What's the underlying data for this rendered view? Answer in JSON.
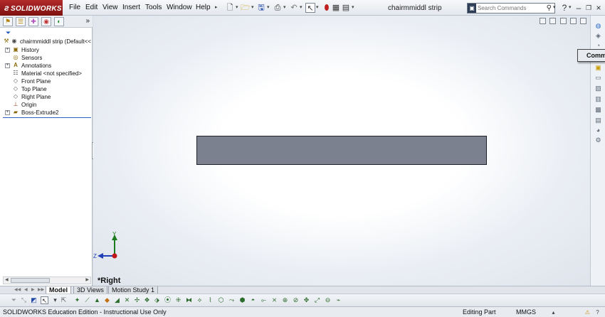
{
  "app": {
    "brand": "SOLIDWORKS",
    "document_title": "chairmmiddl strip"
  },
  "menu": [
    "File",
    "Edit",
    "View",
    "Insert",
    "Tools",
    "Window",
    "Help"
  ],
  "search": {
    "placeholder": "Search Commands"
  },
  "tree": {
    "root": "chairmmiddl strip  (Default<<",
    "items": [
      "History",
      "Sensors",
      "Annotations",
      "Material <not specified>",
      "Front Plane",
      "Top Plane",
      "Right Plane",
      "Origin",
      "Boss-Extrude2"
    ]
  },
  "viewport": {
    "view_label": "*Right",
    "part_fill": "#7c8190",
    "triad": {
      "y_label": "Y",
      "z_label": "Z"
    }
  },
  "command_flyout": "Comm",
  "bottom_tabs": [
    "Model",
    "3D Views",
    "Motion Study 1"
  ],
  "status": {
    "edition": "SOLIDWORKS Education Edition - Instructional Use Only",
    "mode": "Editing Part",
    "units": "MMGS"
  }
}
